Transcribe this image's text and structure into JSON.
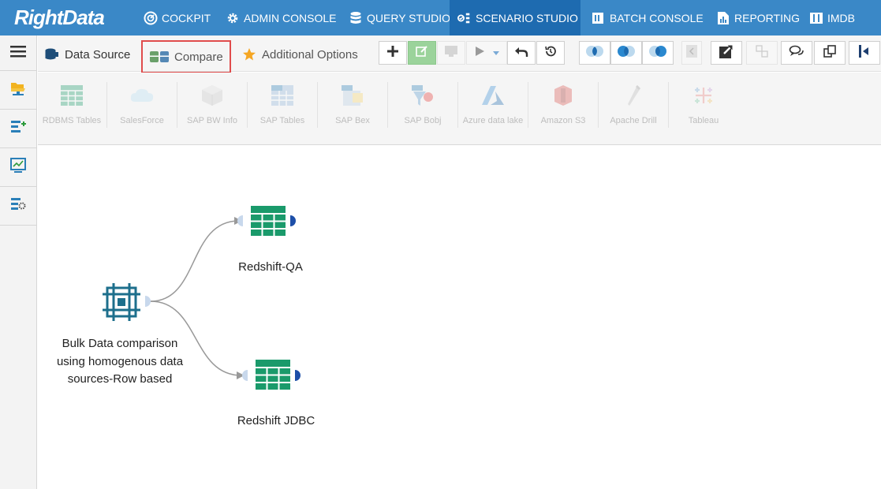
{
  "app": {
    "logo_text": "RightData"
  },
  "topnav": {
    "items": [
      {
        "label": "COCKPIT",
        "icon": "speedometer-icon"
      },
      {
        "label": "ADMIN CONSOLE",
        "icon": "gear-icon"
      },
      {
        "label": "QUERY STUDIO",
        "icon": "database-icon"
      },
      {
        "label": "SCENARIO STUDIO",
        "icon": "scenario-icon",
        "active": true
      },
      {
        "label": "BATCH CONSOLE",
        "icon": "batch-icon"
      },
      {
        "label": "REPORTING",
        "icon": "report-icon"
      },
      {
        "label": "IMDB",
        "icon": "imdb-icon"
      }
    ]
  },
  "sidebar": {
    "items": [
      {
        "name": "menu-icon"
      },
      {
        "name": "open-folder-icon"
      },
      {
        "name": "add-scenario-icon"
      },
      {
        "name": "dashboard-icon"
      },
      {
        "name": "settings-scenario-icon"
      }
    ]
  },
  "tabs": {
    "data_source": "Data Source",
    "compare": "Compare",
    "additional_options": "Additional Options"
  },
  "connectors": [
    {
      "label": "RDBMS Tables"
    },
    {
      "label": "SalesForce"
    },
    {
      "label": "SAP BW Info"
    },
    {
      "label": "SAP Tables"
    },
    {
      "label": "SAP Bex"
    },
    {
      "label": "SAP Bobj"
    },
    {
      "label": "Azure data lake"
    },
    {
      "label": "Amazon S3"
    },
    {
      "label": "Apache Drill"
    },
    {
      "label": "Tableau"
    }
  ],
  "canvas": {
    "source_node": {
      "label": "Bulk Data comparison using homogenous data sources-Row based"
    },
    "target_nodes": [
      {
        "label": "Redshift-QA"
      },
      {
        "label": "Redshift JDBC"
      }
    ]
  },
  "colors": {
    "nav_bg": "#3a88c7",
    "nav_active": "#1e6bb0",
    "node_green": "#1a9a6b",
    "node_blue": "#1d6f8c",
    "port_blue": "#1d4fa8",
    "highlight_red": "#e04c4c"
  }
}
